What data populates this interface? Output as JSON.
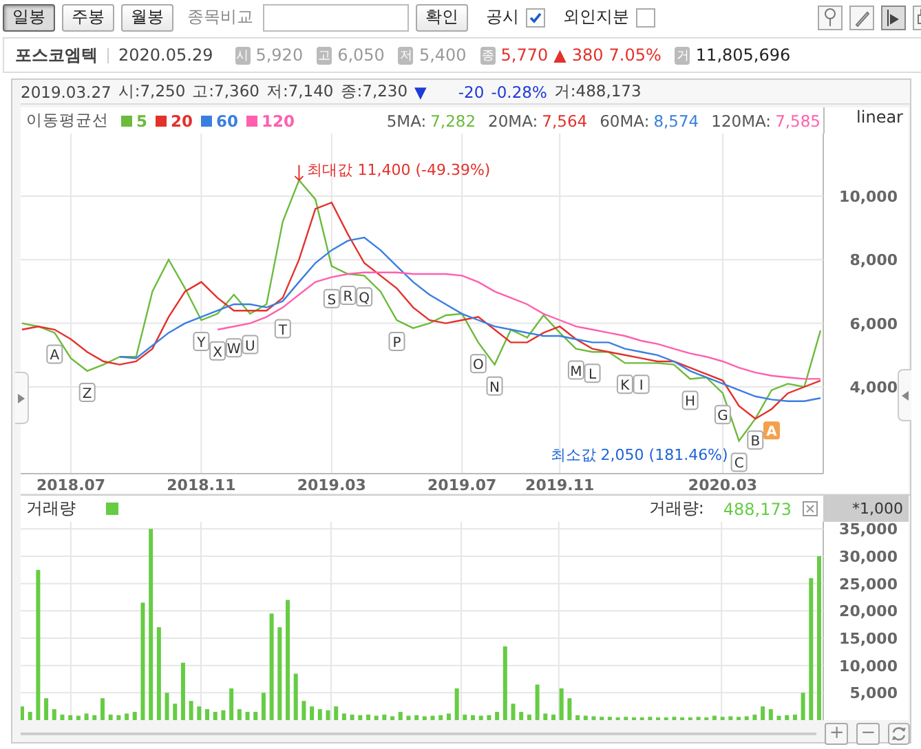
{
  "period_tabs": [
    {
      "label": "일봉",
      "selected": true
    },
    {
      "label": "주봉",
      "selected": false
    },
    {
      "label": "월봉",
      "selected": false
    }
  ],
  "compare": {
    "label": "종목비교",
    "button": "확인"
  },
  "options": [
    {
      "label": "공시",
      "checked": true
    },
    {
      "label": "외인지분",
      "checked": false
    }
  ],
  "quote": {
    "name": "포스코엠텍",
    "date": "2020.05.29",
    "fields": [
      {
        "badge": "시",
        "value": "5,920",
        "kind": "plain"
      },
      {
        "badge": "고",
        "value": "6,050",
        "kind": "plain"
      },
      {
        "badge": "저",
        "value": "5,400",
        "kind": "plain"
      },
      {
        "badge": "종",
        "value": "5,770",
        "kind": "up",
        "arrow": "▲",
        "change": "380",
        "pct": "7.05%"
      },
      {
        "badge": "거",
        "value": "11,805,696",
        "kind": "volume"
      }
    ]
  },
  "cursor": {
    "date": "2019.03.27",
    "fields": [
      "시:7,250",
      "고:7,360",
      "저:7,140",
      "종:7,230"
    ],
    "arrow": "▼",
    "change": "-20",
    "pct": "-0.28%",
    "volume": "거:488,173"
  },
  "price_panel": {
    "legend_title": "이동평균선",
    "scale": "linear",
    "ma_values": [
      {
        "label": "5MA:",
        "value": "7,282"
      },
      {
        "label": "20MA:",
        "value": "7,564"
      },
      {
        "label": "60MA:",
        "value": "8,574"
      },
      {
        "label": "120MA:",
        "value": "7,585"
      }
    ],
    "max_label": "최대값 11,400 (-49.39%)",
    "min_label": "최소값 2,050 (181.46%)",
    "markers": [
      {
        "text": "A",
        "highlighted": false
      },
      {
        "text": "Z",
        "highlighted": false
      },
      {
        "text": "Y",
        "highlighted": false
      },
      {
        "text": "X",
        "highlighted": false
      },
      {
        "text": "W",
        "highlighted": false
      },
      {
        "text": "U",
        "highlighted": false
      },
      {
        "text": "T",
        "highlighted": false
      },
      {
        "text": "S",
        "highlighted": false
      },
      {
        "text": "R",
        "highlighted": false
      },
      {
        "text": "Q",
        "highlighted": false
      },
      {
        "text": "P",
        "highlighted": false
      },
      {
        "text": "O",
        "highlighted": false
      },
      {
        "text": "N",
        "highlighted": false
      },
      {
        "text": "M",
        "highlighted": false
      },
      {
        "text": "L",
        "highlighted": false
      },
      {
        "text": "K",
        "highlighted": false
      },
      {
        "text": "I",
        "highlighted": false
      },
      {
        "text": "H",
        "highlighted": false
      },
      {
        "text": "G",
        "highlighted": false
      },
      {
        "text": "C",
        "highlighted": false
      },
      {
        "text": "B",
        "highlighted": false
      },
      {
        "text": "A",
        "highlighted": true
      }
    ],
    "chart_data": {
      "type": "line",
      "grid": true,
      "categories": [
        null,
        null,
        null,
        "2018.07",
        null,
        null,
        null,
        null,
        null,
        null,
        null,
        "2018.11",
        null,
        null,
        null,
        null,
        null,
        null,
        null,
        "2019.03",
        null,
        null,
        null,
        null,
        null,
        null,
        null,
        "2019.07",
        null,
        null,
        null,
        null,
        null,
        "2019.11",
        null,
        null,
        null,
        null,
        null,
        null,
        null,
        null,
        null,
        "2020.03",
        null,
        null,
        null,
        null,
        null,
        null
      ],
      "ylim": [
        1270,
        11970
      ],
      "yticks": [
        {
          "value": 4000,
          "label": "4,000"
        },
        {
          "value": 6000,
          "label": "6,000"
        },
        {
          "value": 8000,
          "label": "8,000"
        },
        {
          "value": 10000,
          "label": "10,000"
        }
      ],
      "series": [
        {
          "name": "5",
          "color": "#6cbb3c",
          "values": [
            6000,
            5900,
            5700,
            4900,
            4500,
            4700,
            4950,
            4950,
            7000,
            8000,
            7100,
            6100,
            6300,
            6900,
            6300,
            6600,
            9200,
            10500,
            9900,
            7800,
            7550,
            7500,
            7000,
            6100,
            5850,
            6000,
            6250,
            6300,
            5400,
            4700,
            5800,
            5550,
            6250,
            5700,
            5200,
            5100,
            5100,
            4750,
            4750,
            4750,
            4700,
            4250,
            4300,
            3800,
            2300,
            3000,
            3900,
            4100,
            4000,
            5770
          ]
        },
        {
          "name": "20",
          "color": "#e3312b",
          "values": [
            5800,
            5900,
            5800,
            5500,
            5100,
            4800,
            4700,
            4800,
            5200,
            6200,
            7000,
            7300,
            6800,
            6400,
            6400,
            6400,
            6800,
            8000,
            9600,
            9800,
            8800,
            7900,
            7500,
            7100,
            6500,
            6100,
            6000,
            6100,
            6200,
            5800,
            5400,
            5400,
            5700,
            5900,
            5500,
            5200,
            5100,
            5000,
            4900,
            4800,
            4800,
            4600,
            4400,
            4200,
            3400,
            3000,
            3300,
            3800,
            4000,
            4200
          ]
        },
        {
          "name": "60",
          "color": "#3a7fe0",
          "values": [
            null,
            null,
            null,
            null,
            null,
            null,
            4950,
            4900,
            5300,
            5700,
            6000,
            6200,
            6400,
            6600,
            6600,
            6500,
            6700,
            7300,
            7900,
            8300,
            8600,
            8700,
            8300,
            7800,
            7300,
            6900,
            6600,
            6300,
            6100,
            5900,
            5800,
            5700,
            5600,
            5600,
            5500,
            5400,
            5400,
            5200,
            5100,
            5000,
            4800,
            4500,
            4300,
            4100,
            3900,
            3700,
            3600,
            3550,
            3550,
            3650
          ]
        },
        {
          "name": "120",
          "color": "#ff5fae",
          "values": [
            null,
            null,
            null,
            null,
            null,
            null,
            null,
            null,
            null,
            null,
            null,
            null,
            5800,
            5900,
            6000,
            6200,
            6500,
            6900,
            7300,
            7450,
            7550,
            7600,
            7600,
            7600,
            7550,
            7550,
            7550,
            7500,
            7300,
            7000,
            6800,
            6600,
            6300,
            6100,
            5900,
            5800,
            5700,
            5600,
            5450,
            5350,
            5200,
            5050,
            4950,
            4800,
            4600,
            4450,
            4350,
            4300,
            4250,
            4250
          ]
        }
      ]
    }
  },
  "volume_panel": {
    "reading_label": "거래량:",
    "reading": "488,173",
    "unit": "*1,000",
    "chart_data": {
      "type": "bar",
      "grid": true,
      "ylim": [
        0,
        36300
      ],
      "yticks": [
        {
          "value": 5000,
          "label": "5,000"
        },
        {
          "value": 10000,
          "label": "10,000"
        },
        {
          "value": 15000,
          "label": "15,000"
        },
        {
          "value": 20000,
          "label": "20,000"
        },
        {
          "value": 25000,
          "label": "25,000"
        },
        {
          "value": 30000,
          "label": "30,000"
        },
        {
          "value": 35000,
          "label": "35,000"
        }
      ],
      "series": [
        {
          "name": "거래량",
          "color": "#66cc44",
          "values": [
            2500,
            1500,
            27500,
            4000,
            2000,
            1000,
            900,
            800,
            1200,
            900,
            4000,
            1000,
            900,
            1200,
            1500,
            21500,
            35000,
            17000,
            5000,
            3000,
            10500,
            3500,
            2500,
            2000,
            1500,
            1800,
            5800,
            2000,
            1500,
            1500,
            5000,
            19500,
            17000,
            22000,
            8500,
            3500,
            2500,
            2000,
            1800,
            2500,
            1200,
            1000,
            900,
            1000,
            800,
            1000,
            700,
            1500,
            800,
            900,
            700,
            800,
            900,
            1200,
            5800,
            1000,
            900,
            800,
            900,
            1500,
            13500,
            3000,
            1500,
            1000,
            6500,
            1200,
            1000,
            5800,
            4000,
            900,
            800,
            700,
            600,
            600,
            500,
            600,
            500,
            500,
            600,
            500,
            500,
            600,
            500,
            500,
            600,
            500,
            800,
            600,
            700,
            600,
            700,
            1000,
            2500,
            2000,
            800,
            900,
            1000,
            5000,
            26000,
            30000
          ]
        }
      ]
    }
  },
  "zoom_buttons": [
    "+",
    "−"
  ]
}
